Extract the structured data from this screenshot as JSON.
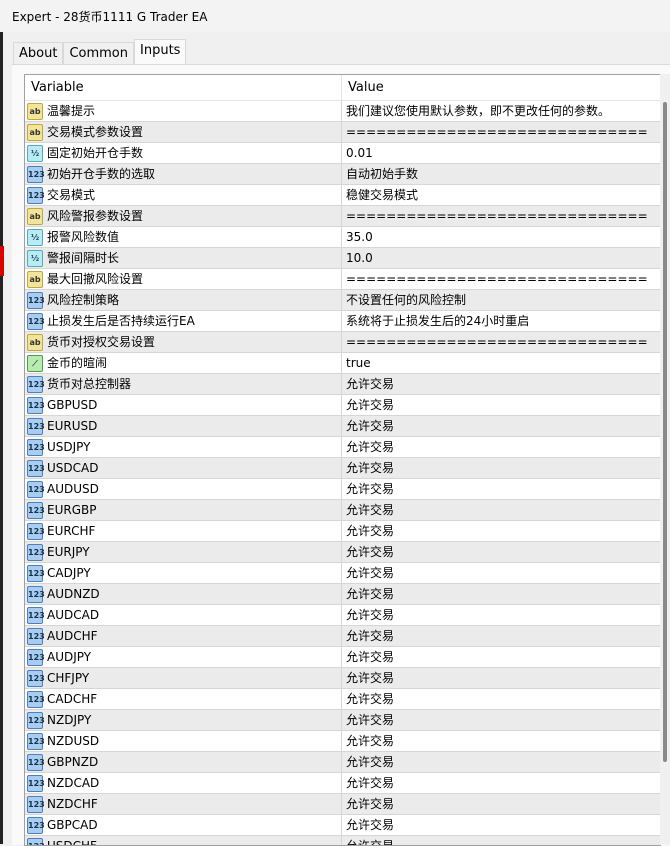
{
  "window": {
    "title": "Expert - 28货币1111 G Trader EA"
  },
  "tabs": [
    {
      "label": "About"
    },
    {
      "label": "Common"
    },
    {
      "label": "Inputs",
      "active": true
    }
  ],
  "table": {
    "headers": {
      "variable": "Variable",
      "value": "Value"
    },
    "rows": [
      {
        "icon": "ab",
        "variable": "温馨提示",
        "value": "我们建议您使用默认参数，即不更改任何的参数。"
      },
      {
        "icon": "ab",
        "variable": "交易模式参数设置",
        "value": "=============================="
      },
      {
        "icon": "half",
        "variable": "固定初始开仓手数",
        "value": "0.01"
      },
      {
        "icon": "123",
        "variable": "初始开仓手数的选取",
        "value": "自动初始手数"
      },
      {
        "icon": "123",
        "variable": "交易模式",
        "value": "稳健交易模式"
      },
      {
        "icon": "ab",
        "variable": "风险警报参数设置",
        "value": "=============================="
      },
      {
        "icon": "half",
        "variable": "报警风险数值",
        "value": "35.0"
      },
      {
        "icon": "half",
        "variable": "警报间隔时长",
        "value": "10.0"
      },
      {
        "icon": "ab",
        "variable": "最大回撤风险设置",
        "value": "=============================="
      },
      {
        "icon": "123",
        "variable": "风险控制策略",
        "value": "不设置任何的风险控制"
      },
      {
        "icon": "123",
        "variable": "止损发生后是否持续运行EA",
        "value": "系统将于止损发生后的24小时重启"
      },
      {
        "icon": "ab",
        "variable": "货币对授权交易设置",
        "value": "=============================="
      },
      {
        "icon": "bool",
        "variable": "金币的暄闹",
        "value": "true"
      },
      {
        "icon": "123",
        "variable": "货币对总控制器",
        "value": "允许交易"
      },
      {
        "icon": "123",
        "variable": "GBPUSD",
        "value": "允许交易"
      },
      {
        "icon": "123",
        "variable": "EURUSD",
        "value": "允许交易"
      },
      {
        "icon": "123",
        "variable": "USDJPY",
        "value": "允许交易"
      },
      {
        "icon": "123",
        "variable": "USDCAD",
        "value": "允许交易"
      },
      {
        "icon": "123",
        "variable": "AUDUSD",
        "value": "允许交易"
      },
      {
        "icon": "123",
        "variable": "EURGBP",
        "value": "允许交易"
      },
      {
        "icon": "123",
        "variable": "EURCHF",
        "value": "允许交易"
      },
      {
        "icon": "123",
        "variable": "EURJPY",
        "value": "允许交易"
      },
      {
        "icon": "123",
        "variable": "CADJPY",
        "value": "允许交易"
      },
      {
        "icon": "123",
        "variable": "AUDNZD",
        "value": "允许交易"
      },
      {
        "icon": "123",
        "variable": "AUDCAD",
        "value": "允许交易"
      },
      {
        "icon": "123",
        "variable": "AUDCHF",
        "value": "允许交易"
      },
      {
        "icon": "123",
        "variable": "AUDJPY",
        "value": "允许交易"
      },
      {
        "icon": "123",
        "variable": "CHFJPY",
        "value": "允许交易"
      },
      {
        "icon": "123",
        "variable": "CADCHF",
        "value": "允许交易"
      },
      {
        "icon": "123",
        "variable": "NZDJPY",
        "value": "允许交易"
      },
      {
        "icon": "123",
        "variable": "NZDUSD",
        "value": "允许交易"
      },
      {
        "icon": "123",
        "variable": "GBPNZD",
        "value": "允许交易"
      },
      {
        "icon": "123",
        "variable": "NZDCAD",
        "value": "允许交易"
      },
      {
        "icon": "123",
        "variable": "NZDCHF",
        "value": "允许交易"
      },
      {
        "icon": "123",
        "variable": "GBPCAD",
        "value": "允许交易"
      },
      {
        "icon": "123",
        "variable": "USDCHF",
        "value": "允许交易"
      }
    ]
  },
  "icon_glyphs": {
    "ab": "ab",
    "half": "½",
    "123": "123",
    "bool": "⟋"
  }
}
